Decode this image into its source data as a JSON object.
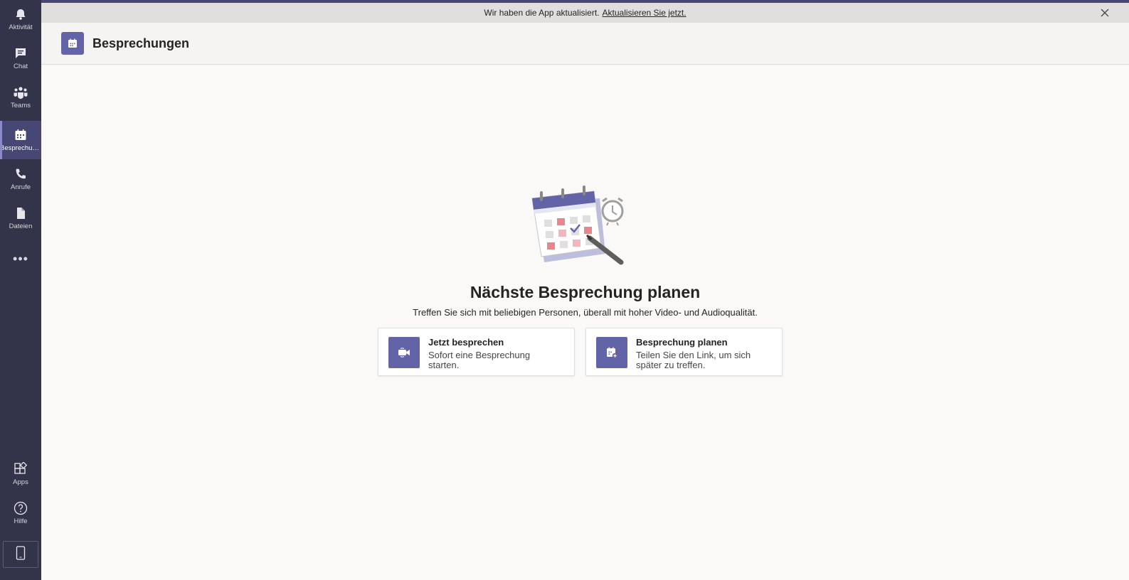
{
  "rail": {
    "items": [
      {
        "label": "Aktivität",
        "icon": "bell-icon"
      },
      {
        "label": "Chat",
        "icon": "chat-icon"
      },
      {
        "label": "Teams",
        "icon": "teams-icon"
      },
      {
        "label": "Besprechungen",
        "icon": "calendar-icon",
        "active": true
      },
      {
        "label": "Anrufe",
        "icon": "phone-icon"
      },
      {
        "label": "Dateien",
        "icon": "file-icon"
      }
    ],
    "more": "•••",
    "bottom_items": [
      {
        "label": "Apps",
        "icon": "apps-icon"
      },
      {
        "label": "Hilfe",
        "icon": "help-icon"
      }
    ]
  },
  "banner": {
    "text": "Wir haben die App aktualisiert.",
    "link": "Aktualisieren Sie jetzt."
  },
  "header": {
    "title": "Besprechungen"
  },
  "main": {
    "headline": "Nächste Besprechung planen",
    "subline": "Treffen Sie sich mit beliebigen Personen, überall mit hoher Video- und Audioqualität.",
    "cards": [
      {
        "title": "Jetzt besprechen",
        "description": "Sofort eine Besprechung starten.",
        "icon": "video-camera-icon"
      },
      {
        "title": "Besprechung planen",
        "description": "Teilen Sie den Link, um sich später zu treffen.",
        "icon": "calendar-add-icon"
      }
    ]
  },
  "colors": {
    "rail": "#33344a",
    "accent": "#6264a7",
    "banner": "#e1dfdd",
    "background": "#faf9f8"
  }
}
